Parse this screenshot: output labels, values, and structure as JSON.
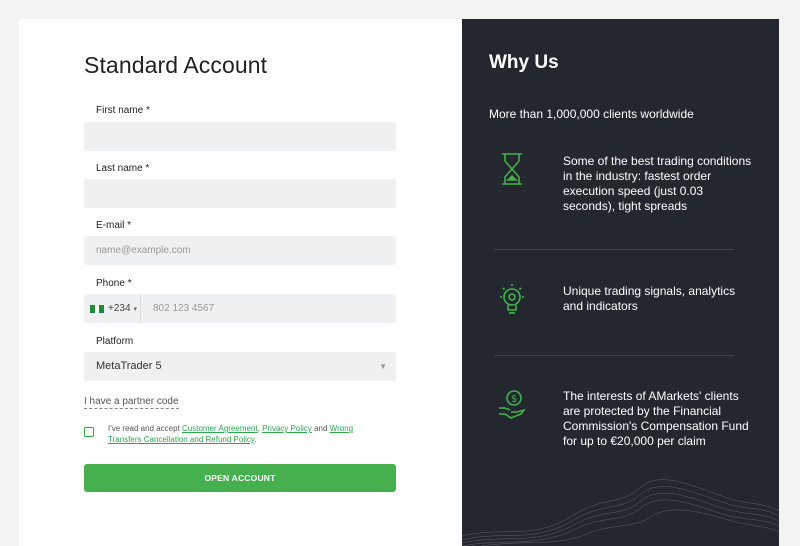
{
  "form": {
    "title": "Standard Account",
    "first_name_label": "First name *",
    "last_name_label": "Last name *",
    "email_label": "E-mail *",
    "email_placeholder": "name@example.com",
    "phone_label": "Phone *",
    "phone_code": "+234",
    "phone_placeholder": "802 123 4567",
    "platform_label": "Platform",
    "platform_value": "MetaTrader 5",
    "partner_link": "I have a partner code",
    "agree_prefix": "I've read and accept ",
    "agree_link1": "Customer Agreement",
    "agree_sep1": ", ",
    "agree_link2": "Privacy Policy",
    "agree_sep2": " and ",
    "agree_link3": "Wrong Transfers Cancellation and Refund Policy",
    "agree_suffix": ".",
    "submit_label": "OPEN ACCOUNT"
  },
  "panel": {
    "title": "Why Us",
    "clients": "More than 1,000,000 clients worldwide",
    "features": [
      {
        "icon": "hourglass-icon",
        "text": "Some of the best trading conditions in the industry: fastest order execution speed (just 0.03 seconds), tight spreads"
      },
      {
        "icon": "lightbulb-icon",
        "text": "Unique trading signals, analytics and indicators"
      },
      {
        "icon": "money-hand-icon",
        "text": "The interests of AMarkets' clients are protected by the Financial Commission's Compensation Fund for up to €20,000 per claim"
      }
    ]
  },
  "colors": {
    "accent": "#46b04f",
    "panel_bg": "#22282d",
    "field_bg": "#eff0f1",
    "flag_green": "#1e8a3a"
  }
}
